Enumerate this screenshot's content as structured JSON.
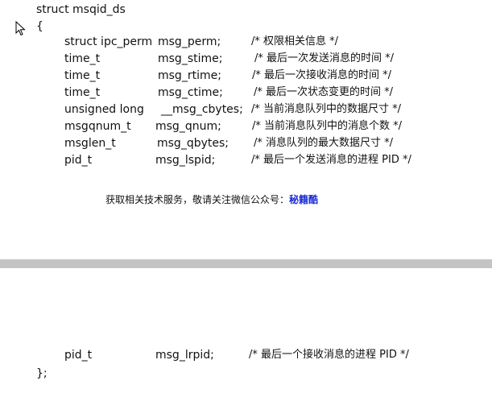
{
  "struct_header": "struct msqid_ds",
  "open_brace": "{",
  "close_brace": "};",
  "fields": [
    {
      "type": "struct ipc_perm",
      "name": "msg_perm;",
      "comment": "/*  权限相关信息  */"
    },
    {
      "type": "time_t",
      "name": "msg_stime;",
      "comment": "/*  最后一次发送消息的时间  */"
    },
    {
      "type": "time_t",
      "name": "msg_rtime;",
      "comment": "/*  最后一次接收消息的时间  */"
    },
    {
      "type": "time_t",
      "name": "msg_ctime;",
      "comment": "/*  最后一次状态变更的时间  */"
    },
    {
      "type": "unsigned long",
      "name": "__msg_cbytes;",
      "comment": "/*  当前消息队列中的数据尺寸  */"
    },
    {
      "type": "msgqnum_t",
      "name": "msg_qnum;",
      "comment": "/*  当前消息队列中的消息个数  */"
    },
    {
      "type": "msglen_t",
      "name": "msg_qbytes;",
      "comment": "/*  消息队列的最大数据尺寸  */"
    },
    {
      "type": "pid_t",
      "name": "msg_lspid;",
      "comment": "/*  最后一个发送消息的进程 PID */"
    }
  ],
  "last_field": {
    "type": "pid_t",
    "name": "msg_lrpid;",
    "comment": "/*  最后一个接收消息的进程 PID */"
  },
  "notice": {
    "text": "获取相关技术服务，敬请关注微信公众号：",
    "brand": "秘籍酷"
  },
  "colors": {
    "divider": "#c4c4c4",
    "brand": "#1a2bd6"
  },
  "icons": {
    "cursor": "mouse-pointer-icon"
  }
}
